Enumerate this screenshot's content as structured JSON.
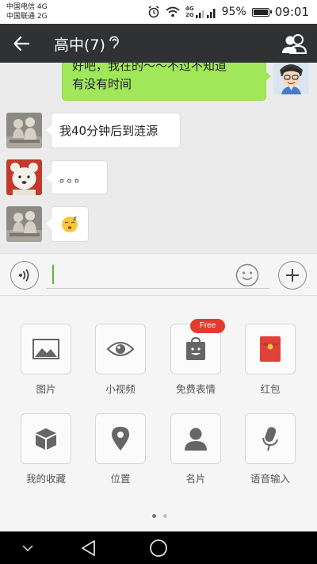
{
  "status_bar": {
    "carrier1": "中国电信 4G",
    "carrier2": "中国联通 2G",
    "battery": "95%",
    "time": "09:01",
    "net_tag_top": "4G",
    "net_tag_bottom": "2G"
  },
  "header": {
    "title": "高中(7)",
    "back_icon": "back-arrow-icon",
    "earpiece_icon": "earpiece-mode-icon",
    "members_icon": "group-members-icon"
  },
  "messages": [
    {
      "side": "right",
      "line1": "好吧，我在的～～不过不知道",
      "line2": "有没有时间"
    },
    {
      "side": "left",
      "text": "我40分钟后到涟源"
    },
    {
      "side": "left",
      "text": "。。。"
    },
    {
      "side": "left",
      "text": "",
      "emoji": "sleepy-face-emoji"
    }
  ],
  "input_bar": {
    "text": "",
    "voice_icon": "voice-input-icon",
    "emoji_icon": "emoji-icon",
    "plus_icon": "plus-icon"
  },
  "tools": [
    {
      "label": "图片",
      "icon": "picture-icon"
    },
    {
      "label": "小视频",
      "icon": "eye-icon"
    },
    {
      "label": "免费表情",
      "icon": "sticker-bag-icon",
      "badge": "Free"
    },
    {
      "label": "红包",
      "icon": "red-packet-icon"
    },
    {
      "label": "我的收藏",
      "icon": "box-icon"
    },
    {
      "label": "位置",
      "icon": "location-pin-icon"
    },
    {
      "label": "名片",
      "icon": "contact-card-icon"
    },
    {
      "label": "语音输入",
      "icon": "microphone-icon"
    }
  ],
  "pager": {
    "pages": 2,
    "current": 1
  },
  "colors": {
    "title_bar": "#2f3133",
    "bubble_me": "#a0e75a",
    "badge": "#e6392e",
    "red_packet": "#e0413a"
  }
}
